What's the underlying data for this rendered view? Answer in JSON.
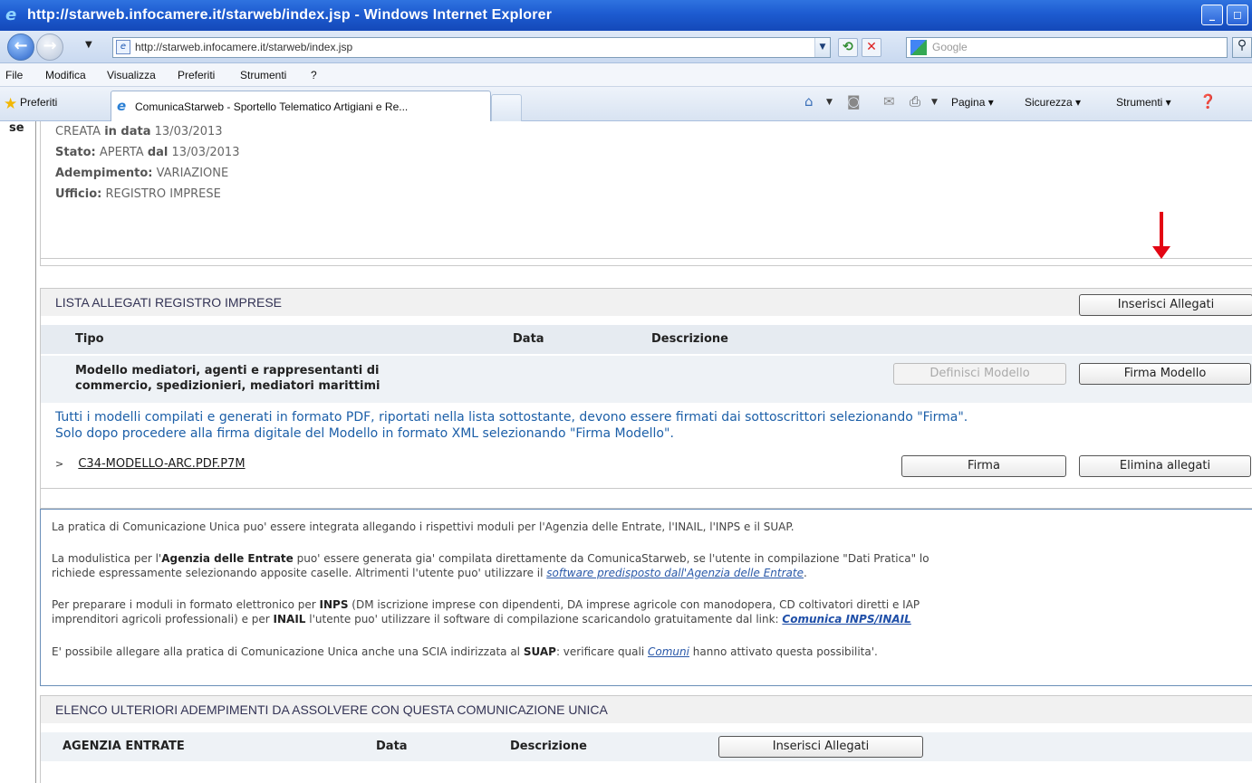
{
  "window": {
    "title": "http://starweb.infocamere.it/starweb/index.jsp - Windows Internet Explorer",
    "minimize_glyph": "_",
    "maximize_glyph": "◻"
  },
  "address_bar": {
    "url": "http://starweb.infocamere.it/starweb/index.jsp",
    "search_placeholder": "Google"
  },
  "menu": [
    "File",
    "Modifica",
    "Visualizza",
    "Preferiti",
    "Strumenti",
    "?"
  ],
  "favorites_bar": {
    "favorites_label": "Preferiti",
    "tab_label": "ComunicaStarweb - Sportello Telematico Artigiani e Re...",
    "commands": [
      "Pagina ▾",
      "Sicurezza ▾",
      "Strumenti ▾"
    ]
  },
  "left_strip": {
    "label": "se"
  },
  "pratica": {
    "created_prefix": "CREATA",
    "created_in": "in data",
    "created_date": "13/03/2013",
    "status_label": "Stato:",
    "status_value": "APERTA",
    "status_since_label": "dal",
    "status_since": "13/03/2013",
    "adempimento_label": "Adempimento:",
    "adempimento_value": "VARIAZIONE",
    "ufficio_label": "Ufficio:",
    "ufficio_value": "REGISTRO IMPRESE"
  },
  "allegati": {
    "section_title": "LISTA ALLEGATI REGISTRO IMPRESE",
    "insert_button": "Inserisci Allegati",
    "columns": [
      "Tipo",
      "Data",
      "Descrizione"
    ],
    "model_line1": "Modello mediatori, agenti e rappresentanti di",
    "model_line2": "commercio, spedizionieri, mediatori marittimi",
    "define_button": "Definisci Modello",
    "sign_model_button": "Firma Modello",
    "note_line1": "Tutti i modelli compilati e generati in formato PDF, riportati nella lista sottostante, devono essere firmati dai sottoscrittori selezionando \"Firma\".",
    "note_line2": "Solo dopo procedere alla firma digitale del Modello in formato XML selezionando \"Firma Modello\".",
    "file_name": "C34-MODELLO-ARC.PDF.P7M",
    "sign_button": "Firma",
    "delete_button": "Elimina allegati"
  },
  "info": {
    "p1": "La pratica di Comunicazione Unica puo' essere integrata allegando i rispettivi moduli per l'Agenzia delle Entrate, l'INAIL, l'INPS e il SUAP.",
    "p2_a": "La modulistica per l'",
    "p2_b": "Agenzia delle Entrate",
    "p2_c": " puo' essere generata gia' compilata direttamente da ComunicaStarweb, se l'utente in compilazione \"Dati Pratica\" lo",
    "p2_d": "richiede espressamente selezionando apposite caselle. Altrimenti l'utente puo' utilizzare il ",
    "p2_link": "software predisposto dall'Agenzia delle Entrate",
    "p2_e": ".",
    "p3_a": "Per preparare i moduli in formato elettronico per ",
    "p3_b": "INPS",
    "p3_c": " (DM iscrizione imprese con dipendenti, DA imprese agricole con manodopera, CD coltivatori diretti e IAP",
    "p3_d": "imprenditori agricoli professionali) e per ",
    "p3_e": "INAIL",
    "p3_f": " l'utente puo' utilizzare il software di compilazione scaricandolo gratuitamente dal link: ",
    "p3_link": "Comunica INPS/INAIL",
    "p4_a": "E' possibile allegare alla pratica di Comunicazione Unica anche una SCIA indirizzata al ",
    "p4_b": "SUAP",
    "p4_c": ": verificare quali ",
    "p4_link": "Comuni",
    "p4_d": " hanno attivato questa possibilita'."
  },
  "adempimenti": {
    "section_title": "ELENCO ULTERIORI ADEMPIMENTI DA ASSOLVERE CON QUESTA COMUNICAZIONE UNICA",
    "columns": [
      "AGENZIA ENTRATE",
      "Data",
      "Descrizione"
    ],
    "insert_button": "Inserisci Allegati"
  }
}
